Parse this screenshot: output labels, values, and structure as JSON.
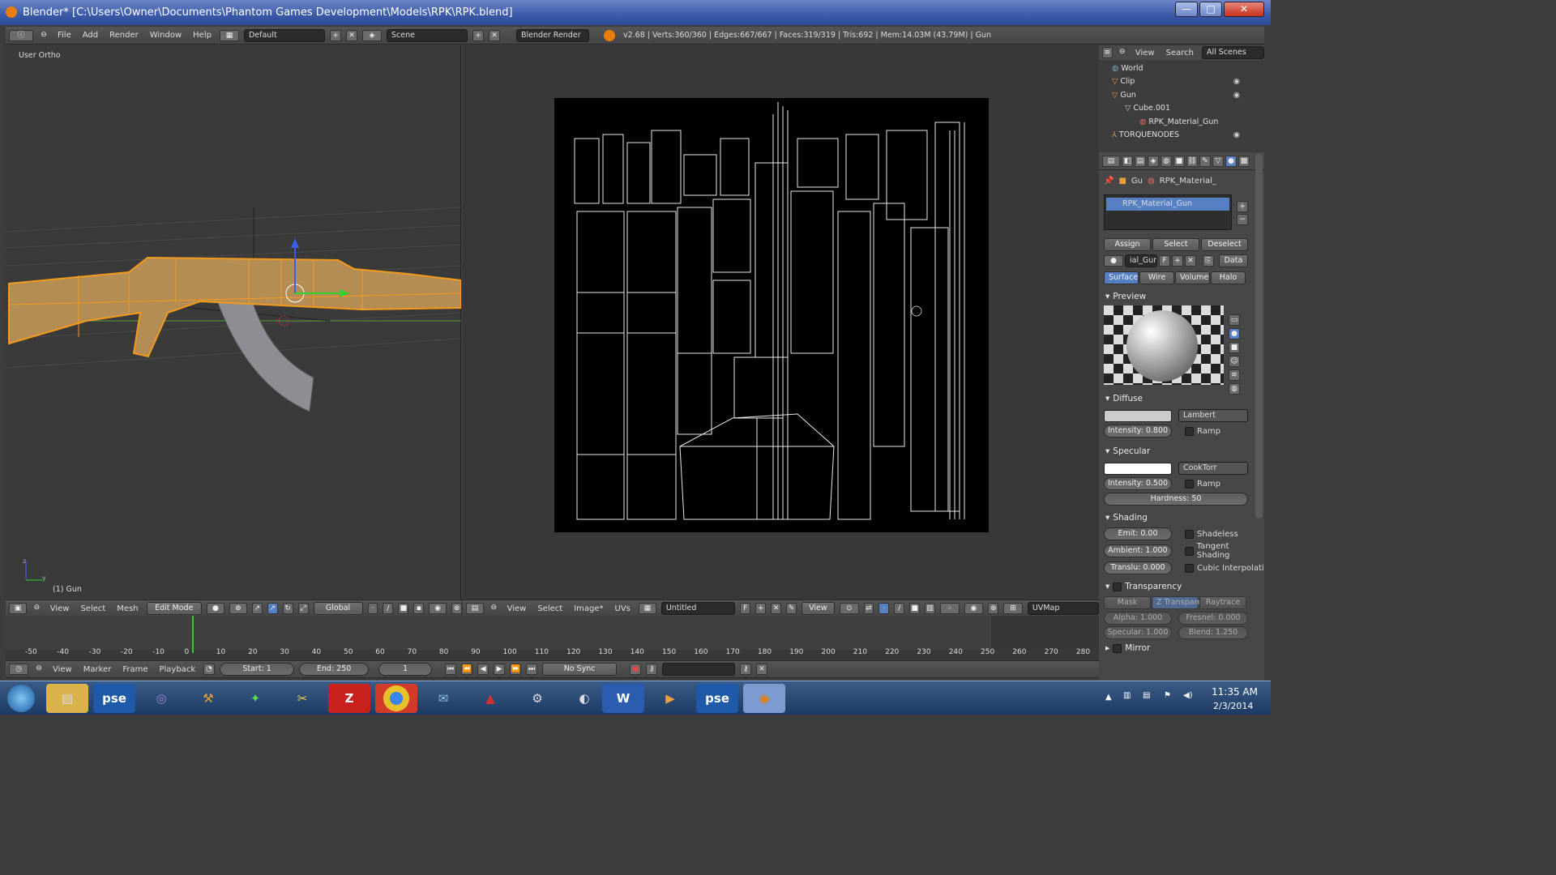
{
  "window": {
    "title": "Blender* [C:\\Users\\Owner\\Documents\\Phantom Games Development\\Models\\RPK\\RPK.blend]",
    "minimize": "—",
    "maximize": "□",
    "close": "✕"
  },
  "info_header": {
    "menus": [
      "File",
      "Add",
      "Render",
      "Window",
      "Help"
    ],
    "layout": "Default",
    "scene": "Scene",
    "engine": "Blender Render",
    "stats": "v2.68 | Verts:360/360 | Edges:667/667 | Faces:319/319 | Tris:692 | Mem:14.03M (43.79M) | Gun"
  },
  "viewport3d": {
    "view_label": "User Ortho",
    "object_label": "(1) Gun",
    "axis_z": "z",
    "axis_y": "y",
    "header": {
      "menus": [
        "View",
        "Select",
        "Mesh"
      ],
      "mode": "Edit Mode",
      "orientation": "Global"
    }
  },
  "uv_editor": {
    "header": {
      "menus": [
        "View",
        "Select",
        "Image*",
        "UVs"
      ],
      "image_name": "Untitled",
      "image_flag": "F",
      "view": "View",
      "uvmap": "UVMap"
    }
  },
  "outliner": {
    "menus": [
      "View",
      "Search"
    ],
    "filter": "All Scenes",
    "items": [
      {
        "label": "World",
        "indent": 0
      },
      {
        "label": "Clip",
        "indent": 0
      },
      {
        "label": "Gun",
        "indent": 0
      },
      {
        "label": "Cube.001",
        "indent": 1
      },
      {
        "label": "RPK_Material_Gun",
        "indent": 2
      },
      {
        "label": "TORQUENODES",
        "indent": 0
      }
    ]
  },
  "properties": {
    "breadcrumb": [
      "Gu",
      "RPK_Material_"
    ],
    "material_slot": "RPK_Material_Gun",
    "slot_buttons": [
      "Assign",
      "Select",
      "Deselect"
    ],
    "material_field": "ial_Gun",
    "material_field_flag": "F",
    "data_label": "Data",
    "tabs": [
      "Surface",
      "Wire",
      "Volume",
      "Halo"
    ],
    "active_tab": "Surface",
    "preview_label": "Preview",
    "diffuse": {
      "label": "Diffuse",
      "shader": "Lambert",
      "intensity": "Intensity: 0.800",
      "ramp": "Ramp"
    },
    "specular": {
      "label": "Specular",
      "shader": "CookTorr",
      "intensity": "Intensity: 0.500",
      "ramp": "Ramp",
      "hardness": "Hardness: 50"
    },
    "shading": {
      "label": "Shading",
      "emit": "Emit: 0.00",
      "ambient": "Ambient: 1.000",
      "translucency": "Translu: 0.000",
      "shadeless": "Shadeless",
      "tangent": "Tangent Shading",
      "cubic": "Cubic Interpolati"
    },
    "transparency": {
      "label": "Transparency",
      "modes": [
        "Mask",
        "Z Transparenc",
        "Raytrace"
      ],
      "alpha": "Alpha: 1.000",
      "fresnel": "Fresnel: 0.000",
      "specular": "Specular: 1.000",
      "blend": "Blend: 1.250"
    },
    "mirror": {
      "label": "Mirror"
    }
  },
  "timeline": {
    "ticks": [
      "-50",
      "-40",
      "-30",
      "-20",
      "-10",
      "0",
      "10",
      "20",
      "30",
      "40",
      "50",
      "60",
      "70",
      "80",
      "90",
      "100",
      "110",
      "120",
      "130",
      "140",
      "150",
      "160",
      "170",
      "180",
      "190",
      "200",
      "210",
      "220",
      "230",
      "240",
      "250",
      "260",
      "270",
      "280"
    ],
    "header": {
      "menus": [
        "View",
        "Marker",
        "Frame",
        "Playback"
      ],
      "start": "Start: 1",
      "end": "End: 250",
      "current": "1",
      "sync": "No Sync"
    }
  },
  "taskbar": {
    "apps": [
      "pse",
      "pse"
    ],
    "time": "11:35 AM",
    "date": "2/3/2014"
  }
}
